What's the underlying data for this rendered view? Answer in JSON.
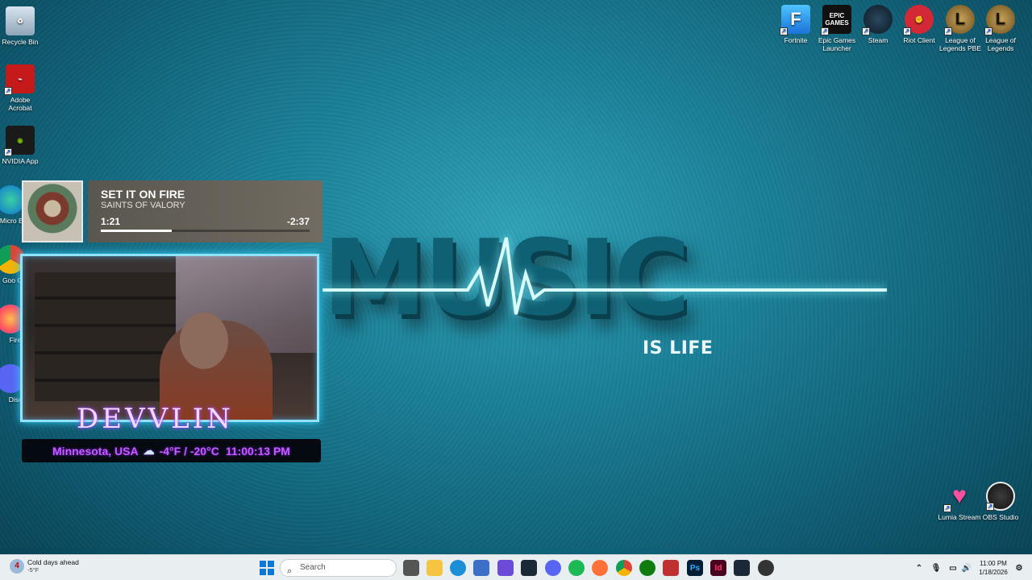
{
  "desktop": {
    "left_icons": [
      {
        "label": "Recycle Bin"
      },
      {
        "label": "Adobe Acrobat"
      },
      {
        "label": "NVIDIA App"
      },
      {
        "label": "Micro Edg"
      },
      {
        "label": "Goo Chr"
      },
      {
        "label": "Fire"
      },
      {
        "label": "Disc"
      }
    ],
    "top_right_icons": [
      {
        "label": "Fortnite"
      },
      {
        "label": "Epic Games Launcher"
      },
      {
        "label": "Steam"
      },
      {
        "label": "Riot Client"
      },
      {
        "label": "League of Legends PBE"
      },
      {
        "label": "League of Legends"
      }
    ],
    "bottom_right_icons": [
      {
        "label": "Lumia Stream"
      },
      {
        "label": "OBS Studio"
      }
    ],
    "icon_glyphs": {
      "fortnite": "F",
      "epic": "EPIC GAMES",
      "league": "L",
      "league_pbe": "L"
    }
  },
  "wallpaper": {
    "headline": "MUSIC",
    "tagline": "IS LIFE"
  },
  "now_playing": {
    "title": "SET IT ON FIRE",
    "artist": "SAINTS OF VALORY",
    "elapsed": "1:21",
    "remaining": "-2:37",
    "progress_fraction": 0.34
  },
  "overlay": {
    "name": "DEVVLIN",
    "location": "Minnesota, USA",
    "temperature": "-4°F / -20°C",
    "time": "11:00:13 PM"
  },
  "taskbar": {
    "weather_title": "Cold days ahead",
    "weather_temp": "-5°F",
    "weather_badge": "4",
    "search_placeholder": "Search",
    "photoshop_glyph": "Ps",
    "indesign_glyph": "Id",
    "clock_time": "11:00 PM",
    "clock_date": "1/18/2026"
  },
  "colors": {
    "accent_overlay": "#c45bff",
    "webcam_border": "#8fe3ff",
    "taskbar_bg": "#e9eef1"
  }
}
